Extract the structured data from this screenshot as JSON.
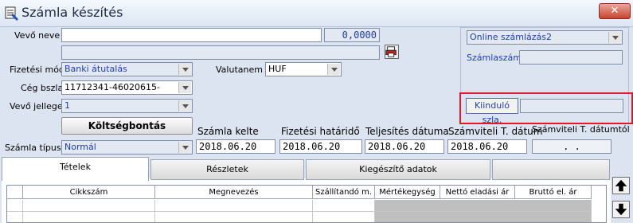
{
  "window": {
    "title": "Számla készítés",
    "close_label": "✕"
  },
  "buyer": {
    "label": "Vevő neve",
    "name_value": "",
    "amount_value": "0,0000"
  },
  "payment": {
    "label": "Fizetési mód",
    "value": "Banki átutalás"
  },
  "currency": {
    "label": "Valutanem",
    "value": "HUF"
  },
  "company_account": {
    "label": "Cég bszla",
    "value": "11712341-46020615-"
  },
  "buyer_type": {
    "label": "Vevő jellege",
    "value": "1"
  },
  "cost_split_button": "Költségbontás",
  "invoice_type": {
    "label": "Számla típusa",
    "value": "Normál"
  },
  "dates": {
    "issue": {
      "label": "Számla kelte",
      "value": "2018.06.20"
    },
    "due": {
      "label": "Fizetési határidő",
      "value": "2018.06.20"
    },
    "fulfillment": {
      "label": "Teljesítés dátuma",
      "value": "2018.06.20"
    },
    "accounting": {
      "label": "Számviteli T. dátum",
      "value": "2018.06.20"
    },
    "accounting_from": {
      "label": "Számviteli T. dátumtól",
      "value": ".  ."
    }
  },
  "right_panel": {
    "online_select": "Online számlázás2",
    "invoice_number_label": "Számlaszám",
    "invoice_number_value": "",
    "issued_button": "Kiinduló szla.",
    "issued_value": ""
  },
  "tabs": [
    "Tételek",
    "Részletek",
    "Kiegészítő adatok",
    ""
  ],
  "table": {
    "columns": [
      "Cikkszám",
      "Megnevezés",
      "Szállítandó m.",
      "Mértékegység",
      "Nettó eladási ár",
      "Bruttó el. ár"
    ]
  },
  "colors": {
    "highlight_frame": "#e0192b",
    "window_bg": "#dbe4f0"
  }
}
